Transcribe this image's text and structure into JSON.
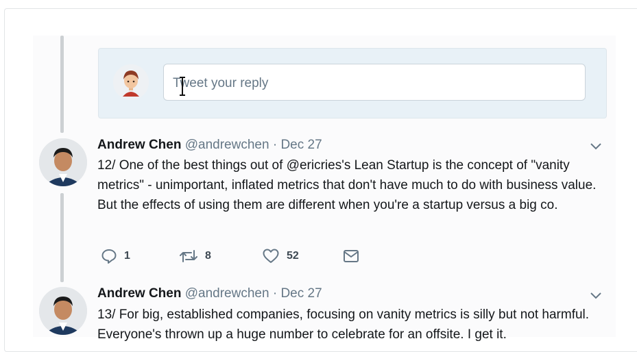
{
  "reply": {
    "placeholder": "Tweet your reply"
  },
  "tweets": [
    {
      "author_name": "Andrew Chen",
      "handle": "@andrewchen",
      "separator": "·",
      "date": "Dec 27",
      "text": "12/ One of the best things out of @ericries's Lean Startup is the concept of \"vanity metrics\" - unimportant, inflated metrics that don't have much to do with business value. But the effects of using them are different when you're a startup versus a big co.",
      "replies": "1",
      "retweets": "8",
      "likes": "52"
    },
    {
      "author_name": "Andrew Chen",
      "handle": "@andrewchen",
      "separator": "·",
      "date": "Dec 27",
      "text": "13/ For big, established companies, focusing on vanity metrics is silly but not harmful. Everyone's thrown up a huge number to celebrate for an offsite. I get it."
    }
  ],
  "icons": {
    "reply": "speech-bubble-icon",
    "retweet": "retweet-icon",
    "like": "heart-icon",
    "dm": "envelope-icon",
    "more": "chevron-down-icon"
  },
  "colors": {
    "text": "#14171a",
    "secondary": "#657786",
    "reply_bg": "#e8f1f7",
    "thread_line": "#ccd0d3"
  }
}
